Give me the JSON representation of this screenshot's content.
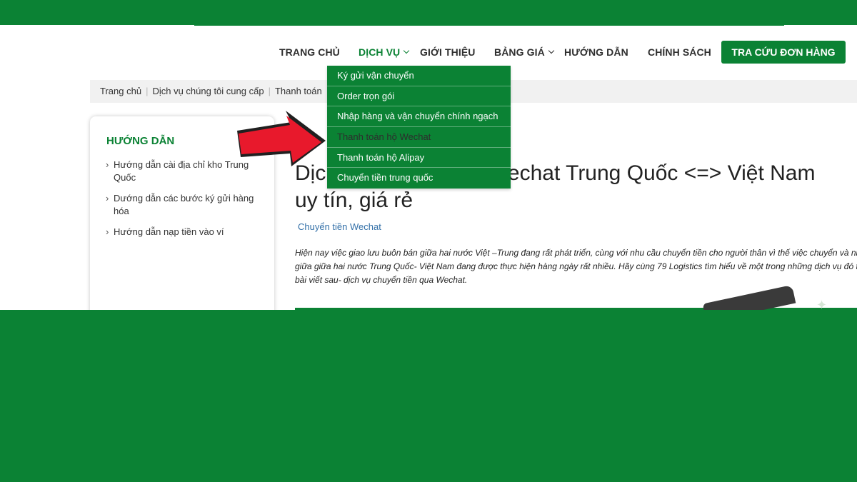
{
  "nav": {
    "items": [
      {
        "label": "TRANG CHỦ"
      },
      {
        "label": "DỊCH VỤ"
      },
      {
        "label": "GIỚI THIỆU"
      },
      {
        "label": "BẢNG GIÁ"
      },
      {
        "label": "HƯỚNG DẪN"
      },
      {
        "label": "CHÍNH SÁCH"
      }
    ],
    "cta_label": "TRA CỨU ĐƠN HÀNG"
  },
  "dropdown": {
    "items": [
      {
        "label": "Ký gửi vận chuyển"
      },
      {
        "label": "Order trọn gói"
      },
      {
        "label": "Nhập hàng và vận chuyển chính ngạch"
      },
      {
        "label": "Thanh toán hộ Wechat"
      },
      {
        "label": "Thanh toán hộ Alipay"
      },
      {
        "label": "Chuyển tiền trung quốc"
      }
    ]
  },
  "breadcrumb": {
    "items": [
      {
        "label": "Trang chủ"
      },
      {
        "label": "Dịch vụ chúng tôi cung cấp"
      },
      {
        "label": "Thanh toán"
      }
    ]
  },
  "sidebar": {
    "title": "HƯỚNG DẪN",
    "items": [
      {
        "label": "Hướng dẫn cài địa chỉ kho Trung Quốc"
      },
      {
        "label": "Dướng dẫn các bước ký gửi hàng hóa"
      },
      {
        "label": "Hướng dẫn nạp tiền vào ví"
      }
    ]
  },
  "article": {
    "title_line1": "Dịch vụ chuyển tiền Wechat Trung Quốc <=> Việt Nam",
    "title_line2": "uy tín, giá rẻ",
    "tag": "Chuyển tiền Wechat",
    "lead": "Hiện nay việc giao lưu buôn bán giữa hai nước Việt –Trung đang rất phát triển, cùng với nhu cầu chuyển tiền cho người thân vì thế việc chuyển và nhận tiền giữa giữa hai nước Trung Quốc- Việt Nam đang được thực hiện hàng ngày rất nhiều. Hãy cùng 79 Logistics tìm hiểu về một trong những dịch vụ đó trong bài viết sau- dịch vụ chuyển tiền qua Wechat."
  },
  "colors": {
    "brand": "#0b8234",
    "arrow": "#e8192c"
  },
  "icons": [
    "chevron-down-icon",
    "chevron-right-icon",
    "red-arrow-annotation"
  ]
}
